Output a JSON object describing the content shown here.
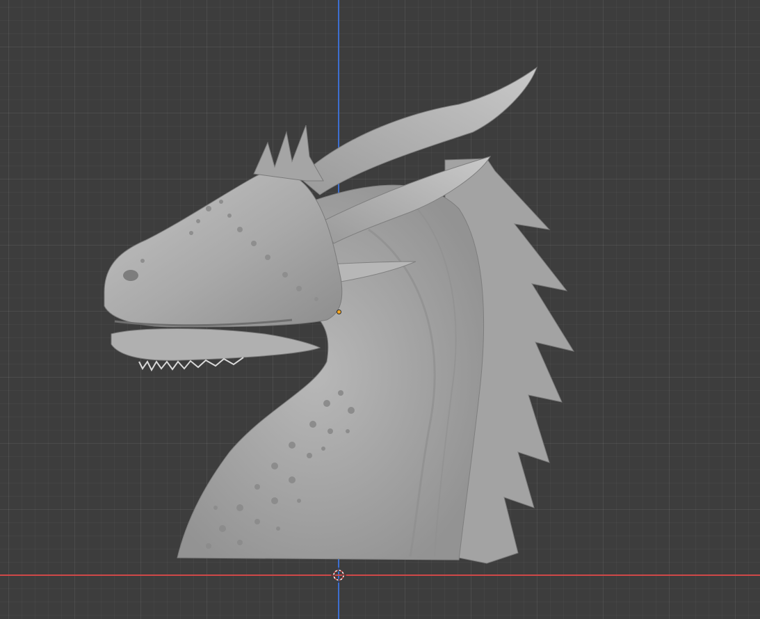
{
  "app": "3D viewport",
  "viewport": {
    "background_color": "#3d3d3d",
    "x_axis_color": "#d04848",
    "z_axis_color": "#3d6fd0",
    "origin_color": "#f5a623",
    "model_color": "#a8a8a8",
    "object_icon": "dragon-bust-sculpt",
    "cursor_icon": "3d-cursor-icon"
  }
}
